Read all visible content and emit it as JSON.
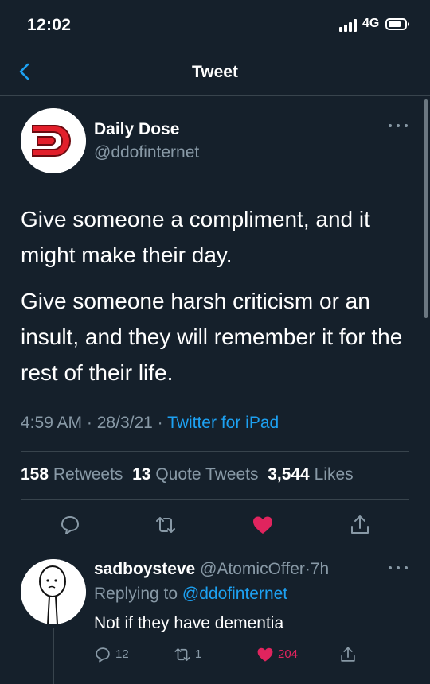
{
  "status_bar": {
    "time": "12:02",
    "network": "4G"
  },
  "nav": {
    "title": "Tweet",
    "back_icon": "chevron-left-icon"
  },
  "tweet": {
    "author_name": "Daily Dose",
    "author_handle": "@ddofinternet",
    "paragraphs": [
      "Give someone a compliment, and it might make their day.",
      "Give someone harsh criticism or an insult, and they will remember it for the rest of their life."
    ],
    "time": "4:59 AM",
    "date": "28/3/21",
    "source": "Twitter for iPad",
    "separator": "·",
    "stats": {
      "retweets_count": "158",
      "retweets_label": "Retweets",
      "quotes_count": "13",
      "quotes_label": "Quote Tweets",
      "likes_count": "3,544",
      "likes_label": "Likes"
    },
    "liked": true
  },
  "reply": {
    "author_name": "sadboysteve",
    "author_handle": "@AtomicOffer",
    "age": "7h",
    "replying_prefix": "Replying to",
    "replying_to": "@ddofinternet",
    "text": "Not if they have dementia",
    "reply_count": "12",
    "retweet_count": "1",
    "like_count": "204"
  },
  "colors": {
    "background": "#15202b",
    "text": "#ffffff",
    "secondary": "#8899a6",
    "accent": "#1da1f2",
    "like": "#e0245e",
    "border": "#38444d"
  }
}
